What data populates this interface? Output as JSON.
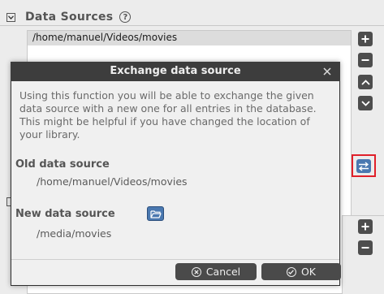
{
  "section": {
    "title": "Data Sources",
    "collapse_glyph": "⊟",
    "help_glyph": "?"
  },
  "data_sources": {
    "items": [
      "/home/manuel/Videos/movies"
    ]
  },
  "side_buttons": {
    "add_glyph": "+",
    "remove_glyph": "−"
  },
  "dialog": {
    "title": "Exchange data source",
    "close_glyph": "✕",
    "description": "Using this function you will be able to exchange the given data source with a new one for all entries in the database. This might be helpful if you have changed the location of your library.",
    "old_label": "Old data source",
    "old_value": "/home/manuel/Videos/movies",
    "new_label": "New data source",
    "new_value": "/media/movies",
    "cancel_label": "Cancel",
    "ok_label": "OK"
  },
  "icons": {
    "collapse": "collapse-icon",
    "help": "help-icon",
    "add": "plus-icon",
    "remove": "minus-icon",
    "up": "chevron-up-icon",
    "down": "chevron-down-icon",
    "exchange": "exchange-arrows-icon",
    "folder": "folder-open-icon",
    "close": "close-icon",
    "cancel": "cancel-icon",
    "ok": "check-icon"
  },
  "colors": {
    "accent": "#4a78b0",
    "highlight_border": "#e0202a",
    "titlebar": "#3d3d3d",
    "button": "#4a4a4a"
  }
}
